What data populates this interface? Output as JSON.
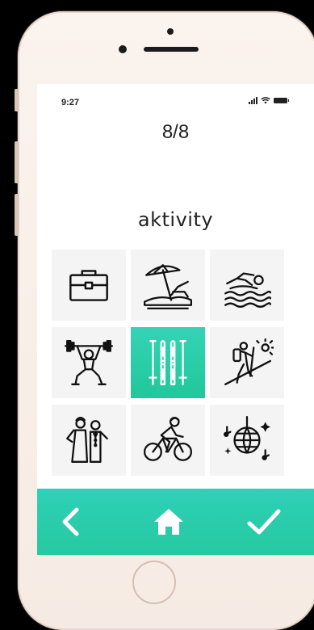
{
  "status_bar": {
    "time": "9:27"
  },
  "progress": {
    "text": "8/8"
  },
  "category": {
    "title": "aktivity"
  },
  "activities": [
    {
      "name": "briefcase-icon",
      "selected": false
    },
    {
      "name": "beach-umbrella-icon",
      "selected": false
    },
    {
      "name": "swimmer-icon",
      "selected": false
    },
    {
      "name": "weightlifter-icon",
      "selected": false
    },
    {
      "name": "skis-icon",
      "selected": true
    },
    {
      "name": "hiker-icon",
      "selected": false
    },
    {
      "name": "wedding-couple-icon",
      "selected": false
    },
    {
      "name": "cyclist-icon",
      "selected": false
    },
    {
      "name": "disco-ball-icon",
      "selected": false
    }
  ],
  "navigation": {
    "back": "chevron-left-icon",
    "home": "home-icon",
    "confirm": "checkmark-icon"
  },
  "colors": {
    "accent": "#2bcdaa",
    "tile_bg": "#f4f4f4",
    "phone_shell": "#f8eee8"
  }
}
